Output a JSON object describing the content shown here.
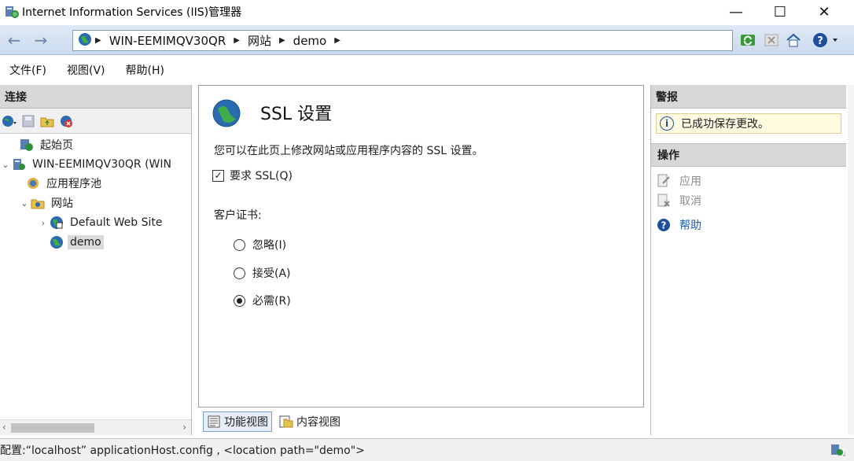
{
  "window": {
    "title": "Internet Information Services (IIS)管理器",
    "minimize": "—",
    "maximize": "☐",
    "close": "✕"
  },
  "address": {
    "segments": [
      "WIN-EEMIMQV30QR",
      "网站",
      "demo"
    ]
  },
  "menu": {
    "items": [
      "文件(F)",
      "视图(V)",
      "帮助(H)"
    ]
  },
  "connections": {
    "header": "连接",
    "tree": [
      {
        "label": "起始页"
      },
      {
        "label": "WIN-EEMIMQV30QR (WIN"
      },
      {
        "label": "应用程序池"
      },
      {
        "label": "网站"
      },
      {
        "label": "Default Web Site"
      },
      {
        "label": "demo"
      }
    ]
  },
  "main": {
    "title": "SSL 设置",
    "description": "您可以在此页上修改网站或应用程序内容的 SSL 设置。",
    "require_ssl": {
      "label": "要求 SSL(Q)",
      "checked": true
    },
    "client_cert_label": "客户证书:",
    "radios": [
      {
        "label": "忽略(I)",
        "selected": false
      },
      {
        "label": "接受(A)",
        "selected": false
      },
      {
        "label": "必需(R)",
        "selected": true
      }
    ]
  },
  "view_tabs": {
    "features": "功能视图",
    "content": "内容视图"
  },
  "alerts": {
    "header": "警报",
    "message": "已成功保存更改。"
  },
  "actions": {
    "header": "操作",
    "apply": "应用",
    "cancel": "取消",
    "help": "帮助"
  },
  "status": {
    "text": "配置:“localhost” applicationHost.config , <location path=\"demo\">"
  },
  "colors": {
    "accent": "#1a5cb8",
    "alert_bg": "#fffbe0"
  }
}
